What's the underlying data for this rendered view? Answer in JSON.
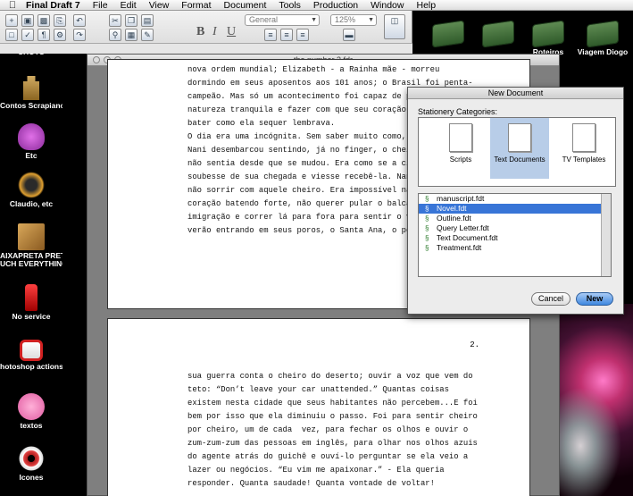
{
  "menubar": {
    "app": "Final Draft 7",
    "items": [
      "File",
      "Edit",
      "View",
      "Format",
      "Document",
      "Tools",
      "Production",
      "Window",
      "Help"
    ]
  },
  "toolbar": {
    "style_select": "General",
    "zoom_select": "125%",
    "bold": "B",
    "italic": "I",
    "underline": "U"
  },
  "desktop_left": [
    {
      "label": "SHOTS",
      "icon": "folder-icon"
    },
    {
      "label": "Contos Scrapianos",
      "icon": "castle-icon"
    },
    {
      "label": "Etc",
      "icon": "purple-creature-icon"
    },
    {
      "label": "Claudio, etc",
      "icon": "heart-icon"
    },
    {
      "label": "AIXAPRETA PRETTY",
      "label2": "UCH EVERYTHING",
      "icon": "box-icon"
    },
    {
      "label": "No service",
      "icon": "fire-hydrant-icon"
    },
    {
      "label": "hotoshop actions",
      "icon": "camera-box-icon"
    },
    {
      "label": "textos",
      "icon": "candy-heart-icon"
    },
    {
      "label": "Icones",
      "icon": "eye-icon"
    }
  ],
  "desktop_right": [
    {
      "label": "",
      "icon": "folder-icon"
    },
    {
      "label": "",
      "icon": "folder-icon"
    },
    {
      "label": "Roteiros",
      "icon": "folder-icon"
    },
    {
      "label": "Viagem Diogo",
      "icon": "folder-icon"
    }
  ],
  "document": {
    "title": "the number 3.fdr",
    "page1_lines": [
      "nova ordem mundial; Elizabeth - a Rainha mãe - morreu",
      "dormindo em seus aposentos aos 101 anos; o Brasil foi penta-",
      "campeão. Mas só um acontecimento foi capaz de perturbar sua",
      "natureza tranquila e fazer com que seu coração voltasse a",
      "bater como ela sequer lembrava.",
      "",
      "",
      "O dia era uma incógnita. Sem saber muito como, pisou no chão.",
      "Nani desembarcou sentindo, já no finger, o cheiro que já",
      "não sentia desde que se mudou. Era como se a cidade",
      "soubesse de sua chegada e viesse recebê-la. Nani não pôde",
      "não sorrir com aquele cheiro. Era impossível não sentir o",
      "coração batendo forte, não querer pular o balcão da",
      "imigração e correr lá para fora para sentir o vento de",
      "verão entrando em seus poros, o Santa Ana, o perfume do"
    ],
    "page2_number": "2.",
    "page2_lines": [
      "sua guerra conta o cheiro do deserto; ouvir a voz que vem do",
      "teto: “Don’t leave your car unattended.” Quantas coisas",
      "existem nesta cidade que seus habitantes não percebem...E foi",
      "bem por isso que ela diminuiu o passo. Foi para sentir cheiro",
      "por cheiro, um de cada  vez, para fechar os olhos e ouvir o",
      "zum-zum-zum das pessoas em inglês, para olhar nos olhos azuis",
      "do agente atrás do guichê e ouví-lo perguntar se ela veio a",
      "lazer ou negócios. “Eu vim me apaixonar.” - Ela queria",
      "responder. Quanta saudade! Quanta vontade de voltar!"
    ]
  },
  "new_document": {
    "title": "New Document",
    "categories_label": "Stationery Categories:",
    "categories": [
      "Scripts",
      "Text Documents",
      "TV Templates"
    ],
    "selected_category": "Text Documents",
    "files": [
      "manuscript.fdt",
      "Novel.fdt",
      "Outline.fdt",
      "Query Letter.fdt",
      "Text Document.fdt",
      "Treatment.fdt"
    ],
    "selected_file": "Novel.fdt",
    "cancel_label": "Cancel",
    "new_label": "New"
  }
}
